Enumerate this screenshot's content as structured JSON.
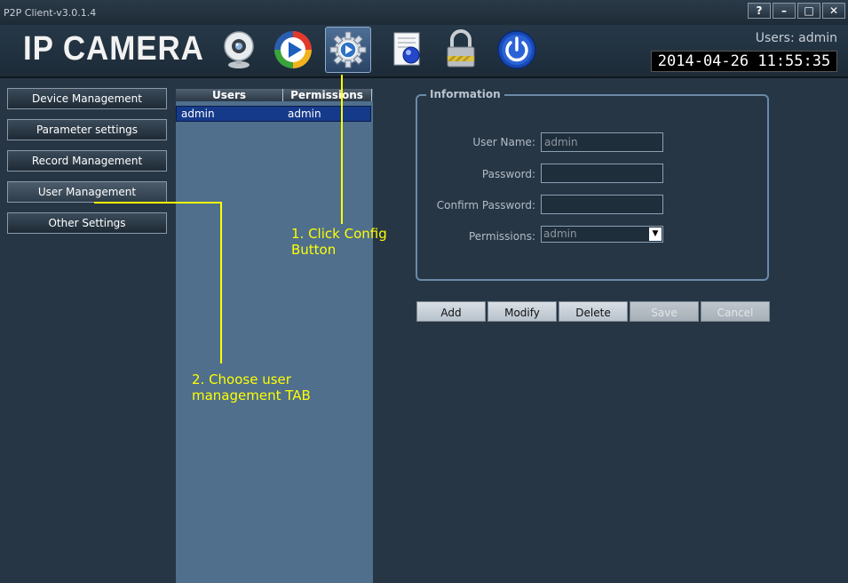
{
  "window": {
    "title": "P2P Client-v3.0.1.4",
    "controls": [
      "?",
      "–",
      "□",
      "✕"
    ]
  },
  "header": {
    "logo": "IP CAMERA",
    "toolbar_icons": [
      "webcam-icon",
      "media-player-icon",
      "config-gear-icon",
      "log-document-icon",
      "lock-icon",
      "power-icon"
    ],
    "active_icon": "config-gear-icon",
    "users_label": "Users: admin",
    "datetime": "2014-04-26 11:55:35"
  },
  "sidebar": {
    "items": [
      {
        "label": "Device Management"
      },
      {
        "label": "Parameter settings"
      },
      {
        "label": "Record Management"
      },
      {
        "label": "User Management"
      },
      {
        "label": "Other Settings"
      }
    ],
    "active_index": 3
  },
  "user_table": {
    "columns": [
      "Users",
      "Permissions"
    ],
    "rows": [
      {
        "user": "admin",
        "permission": "admin"
      }
    ]
  },
  "info": {
    "legend": "Information",
    "fields": {
      "username_label": "User Name:",
      "username_value": "admin",
      "password_label": "Password:",
      "password_value": "",
      "confirm_label": "Confirm Password:",
      "confirm_value": "",
      "permissions_label": "Permissions:",
      "permissions_value": "admin"
    }
  },
  "actions": {
    "add": "Add",
    "modify": "Modify",
    "delete": "Delete",
    "save": "Save",
    "cancel": "Cancel"
  },
  "annotations": {
    "step1": "1. Click Config\nButton",
    "step2": "2. Choose user\nmanagement TAB",
    "color": "#ffff00"
  },
  "colors": {
    "background": "#263645",
    "list_background": "#4f6f8d",
    "selected_row": "#163a8a"
  }
}
